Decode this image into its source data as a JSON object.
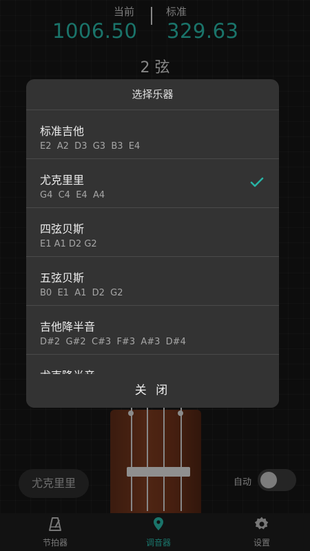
{
  "readout": {
    "current_label": "当前",
    "current_value": "1006.50",
    "standard_label": "标准",
    "standard_value": "329.63"
  },
  "string_label": "2 弦",
  "instrument_button": "尤克里里",
  "auto": {
    "label": "自动",
    "enabled": false
  },
  "dialog": {
    "title": "选择乐器",
    "items": [
      {
        "name": "标准吉他",
        "notes": "E2  A2  D3  G3  B3  E4",
        "selected": false
      },
      {
        "name": "尤克里里",
        "notes": "G4  C4  E4  A4",
        "selected": true
      },
      {
        "name": "四弦贝斯",
        "notes": "E1 A1 D2 G2",
        "selected": false
      },
      {
        "name": "五弦贝斯",
        "notes": "B0  E1  A1  D2  G2",
        "selected": false
      },
      {
        "name": "吉他降半音",
        "notes": "D#2  G#2  C#3  F#3  A#3  D#4",
        "selected": false
      },
      {
        "name": "尤克降半音",
        "notes": "",
        "selected": false
      }
    ],
    "close_label": "关 闭"
  },
  "nav": {
    "items": [
      {
        "label": "节拍器",
        "icon": "metronome-icon",
        "active": false
      },
      {
        "label": "调音器",
        "icon": "tuner-pin-icon",
        "active": true
      },
      {
        "label": "设置",
        "icon": "gear-icon",
        "active": false
      }
    ]
  },
  "colors": {
    "accent": "#28b3a4",
    "dialog_bg": "#333333",
    "background": "#141414"
  }
}
